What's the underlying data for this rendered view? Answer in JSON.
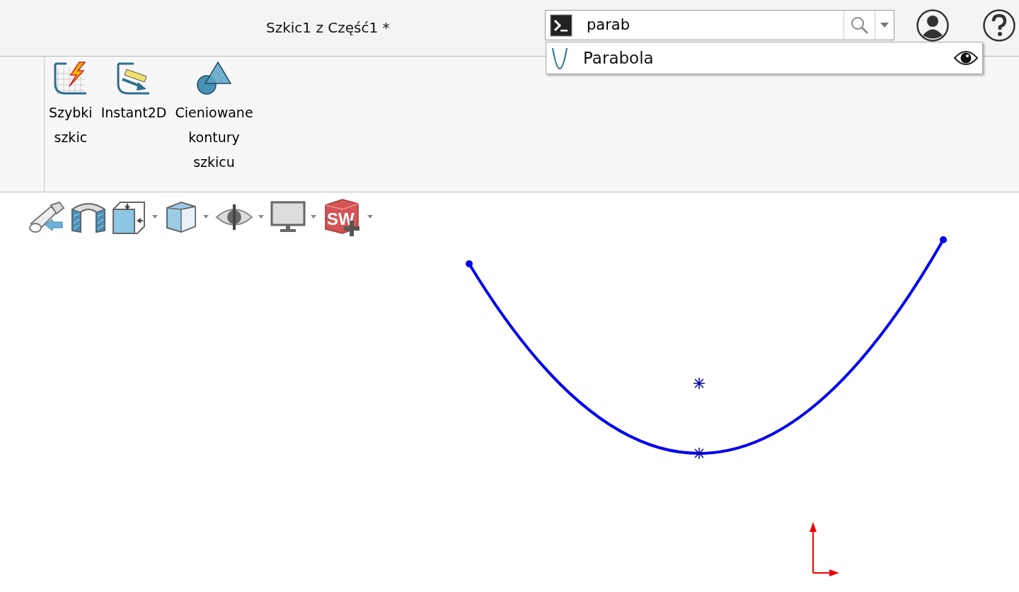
{
  "window": {
    "title": "Szkic1 z Część1 *"
  },
  "search": {
    "value": "parab",
    "suggestions": [
      {
        "label": "Parabola"
      }
    ]
  },
  "ribbon": {
    "buttons": [
      {
        "kind": "quick-sketch",
        "label": "Szybki szkic"
      },
      {
        "kind": "instant2d",
        "label": "Instant2D"
      },
      {
        "kind": "shaded-contours",
        "label": "Cieniowane kontury szkicu"
      }
    ]
  },
  "view_toolbar": [
    {
      "kind": "previous-view",
      "dropdown": false
    },
    {
      "kind": "section-view",
      "dropdown": false
    },
    {
      "kind": "orientation",
      "dropdown": true
    },
    {
      "kind": "display-style",
      "dropdown": true
    },
    {
      "kind": "hide-show",
      "dropdown": true
    },
    {
      "kind": "scene",
      "dropdown": true
    },
    {
      "kind": "logo",
      "dropdown": true,
      "text": "SW"
    }
  ]
}
